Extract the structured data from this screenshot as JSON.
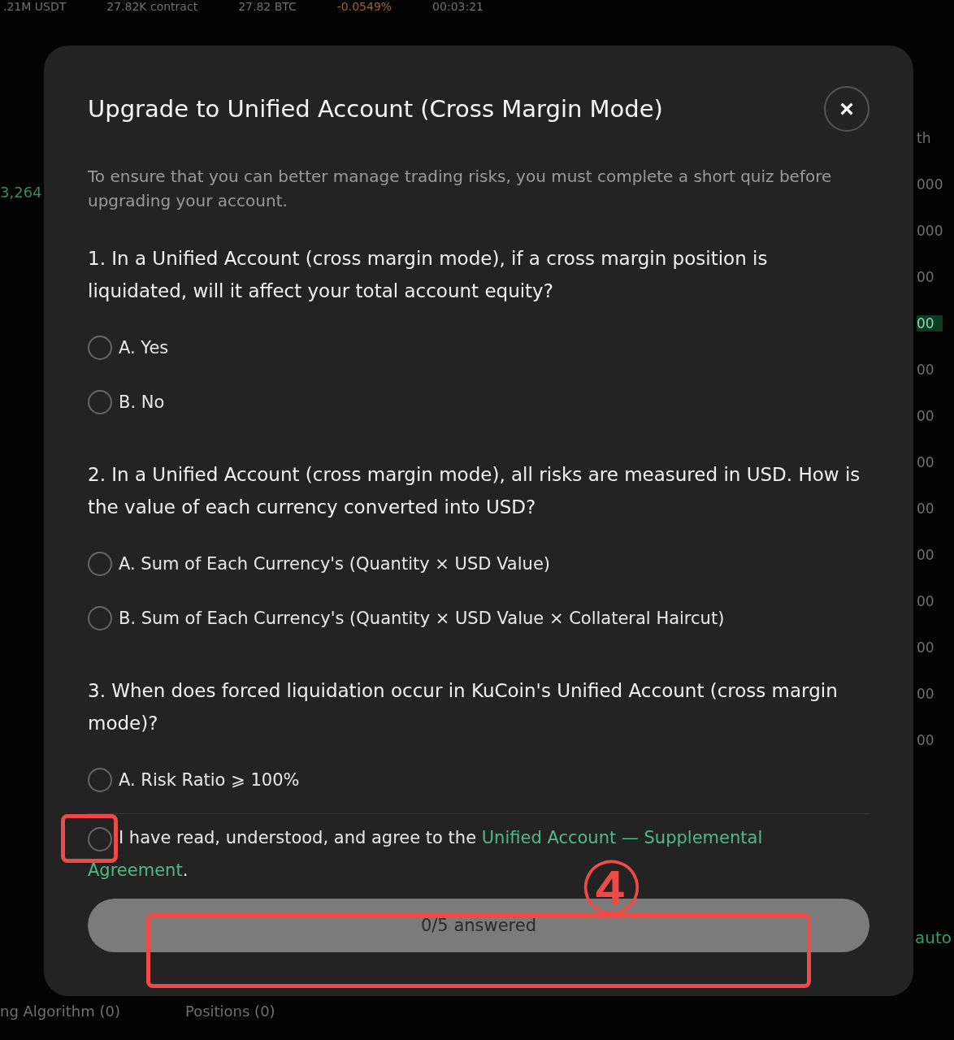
{
  "background": {
    "ticker": [
      ".21M USDT",
      "27.82K contract",
      "27.82 BTC",
      "-0.0549%",
      "00:03:21"
    ],
    "left_price": "3,264",
    "right_labels": [
      "th",
      "000",
      "000",
      "00",
      "00",
      "00",
      "00",
      "00",
      "00",
      "00",
      "00",
      "00",
      "00",
      "00"
    ],
    "right_bottom": "auto",
    "bottom_tabs": [
      "ng Algorithm (0)",
      "Positions (0)"
    ]
  },
  "dialog": {
    "title": "Upgrade to Unified Account (Cross Margin Mode)",
    "close": "×",
    "intro": "To ensure that you can better manage trading risks, you must complete a short quiz before upgrading your account.",
    "questions": [
      {
        "text": "1. In a Unified Account (cross margin mode), if a cross margin position is liquidated, will it affect your total account equity?",
        "options": [
          {
            "label": "A. Yes",
            "selected": false
          },
          {
            "label": "B. No",
            "selected": false
          }
        ]
      },
      {
        "text": "2. In a Unified Account (cross margin mode), all risks are measured in USD. How is the value of each currency converted into USD?",
        "options": [
          {
            "label": "A. Sum of Each Currency's (Quantity × USD Value)",
            "selected": false
          },
          {
            "label": "B. Sum of Each Currency's (Quantity × USD Value × Collateral Haircut)",
            "selected": false
          }
        ]
      },
      {
        "text": "3. When does forced liquidation occur in KuCoin's Unified Account (cross margin mode)?",
        "options": [
          {
            "label": "A. Risk Ratio ⩾ 100%",
            "selected": false
          }
        ]
      }
    ],
    "agreement": {
      "checked": false,
      "text": "I have read, understood, and agree to the ",
      "link": "Unified Account — Supplemental",
      "link_continued": "Agreement",
      "end": "."
    },
    "submit": {
      "label": "0/5 answered",
      "disabled": true
    }
  },
  "annotation": {
    "marker": "④"
  }
}
